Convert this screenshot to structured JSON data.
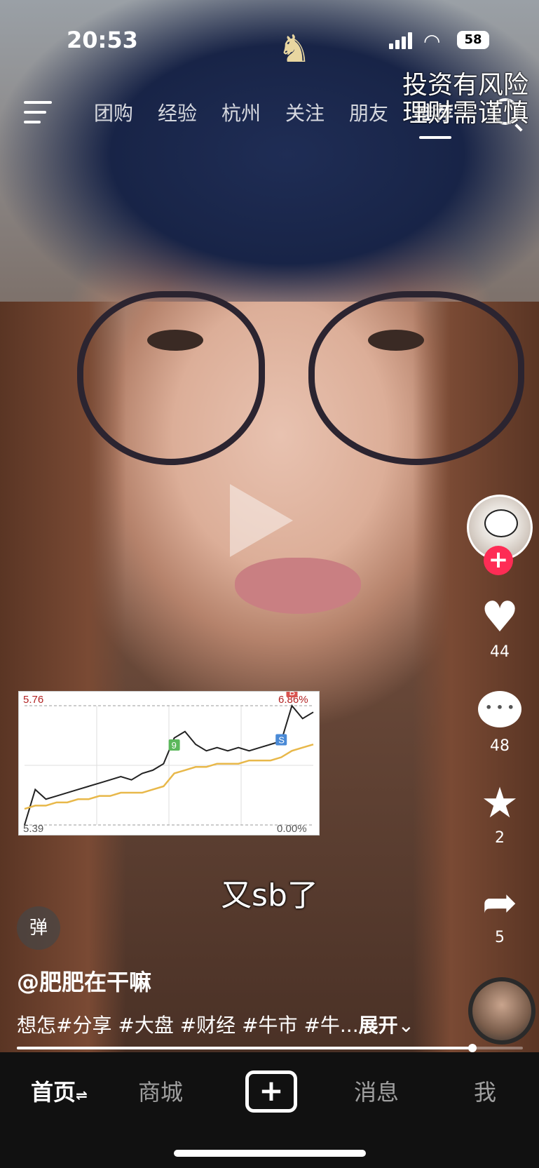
{
  "status_bar": {
    "time": "20:53",
    "battery": "58"
  },
  "top_nav": {
    "tabs": [
      "团购",
      "经验",
      "杭州",
      "关注",
      "朋友",
      "推荐"
    ],
    "active_tab": "推荐",
    "risk_notice": [
      "投资有风险",
      "理财需谨慎"
    ]
  },
  "video": {
    "subtitle": "又sb了"
  },
  "chart_data": {
    "type": "line",
    "series": [
      {
        "values": [
          5.39,
          5.5,
          5.47,
          5.48,
          5.49,
          5.5,
          5.51,
          5.52,
          5.53,
          5.54,
          5.53,
          5.55,
          5.56,
          5.58,
          5.66,
          5.68,
          5.64,
          5.62,
          5.63,
          5.62,
          5.63,
          5.62,
          5.63,
          5.64,
          5.65,
          5.76,
          5.72,
          5.74
        ]
      },
      {
        "values": [
          5.44,
          5.45,
          5.45,
          5.46,
          5.46,
          5.47,
          5.47,
          5.48,
          5.48,
          5.49,
          5.49,
          5.49,
          5.5,
          5.51,
          5.55,
          5.56,
          5.57,
          5.57,
          5.58,
          5.58,
          5.58,
          5.59,
          5.59,
          5.59,
          5.6,
          5.62,
          5.63,
          5.64
        ]
      }
    ],
    "ylim": [
      5.39,
      5.76
    ],
    "y_labels": {
      "top": "5.76",
      "bottom": "5.39",
      "top_right": "6.86%",
      "bottom_right": "0.00%"
    },
    "markers": [
      {
        "label": "9",
        "color": "#5cb85c"
      },
      {
        "label": "S",
        "color": "#4a8ad6"
      },
      {
        "label": "B",
        "color": "#d9534f"
      }
    ],
    "grid": true
  },
  "actions": {
    "likes": "44",
    "comments": "48",
    "favorites": "2",
    "shares": "5",
    "follow_symbol": "+"
  },
  "post": {
    "danmu_label": "弹",
    "author": "@肥肥在干嘛",
    "description": "想怎#分享 #大盘 #财经 #牛市 #牛...",
    "expand_label": "展开",
    "progress": 0.9
  },
  "bottom_nav": {
    "home": "首页",
    "home_suffix": "⇌",
    "mall": "商城",
    "create": "+",
    "messages": "消息",
    "me": "我"
  },
  "colors": {
    "follow": "#fe2c55",
    "chart_price": "#222222",
    "chart_avg": "#e8b84a",
    "chart_label": "#b22222"
  }
}
